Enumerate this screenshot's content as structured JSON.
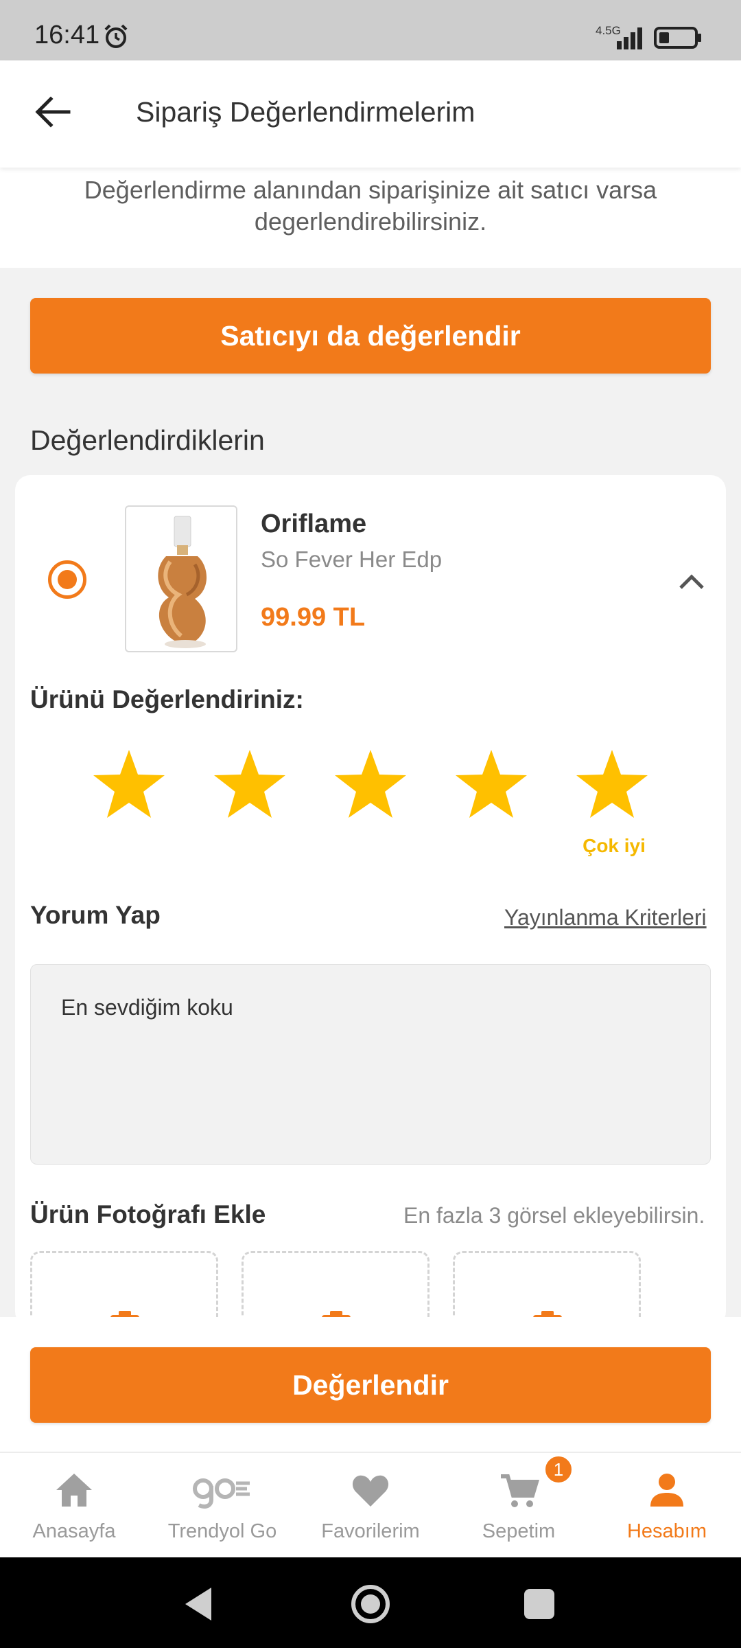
{
  "status_bar": {
    "time": "16:41",
    "network": "4.5G"
  },
  "header": {
    "title": "Sipariş Değerlendirmelerim"
  },
  "info": {
    "line1": "Değerlendirme alanından siparişinize ait satıcı varsa",
    "line2": "degerlendirebilirsiniz."
  },
  "seller_button": {
    "label": "Satıcıyı da değerlendir"
  },
  "reviewed_section": {
    "title": "Değerlendirdiklerin"
  },
  "product": {
    "brand": "Oriflame",
    "name": "So Fever Her Edp",
    "price": "99.99 TL",
    "selected": true
  },
  "rating": {
    "title": "Ürünü Değerlendiriniz:",
    "stars": 5,
    "max_stars": 5,
    "label": "Çok iyi",
    "color": "#ffc000"
  },
  "comment": {
    "title": "Yorum Yap",
    "criteria_link": "Yayınlanma Kriterleri",
    "text": "En sevdiğim koku"
  },
  "photo": {
    "title": "Ürün Fotoğrafı Ekle",
    "hint": "En fazla 3 görsel ekleyebilirsin.",
    "slot_count": 3
  },
  "submit_button": {
    "label": "Değerlendir"
  },
  "bottom_nav": {
    "items": [
      {
        "label": "Anasayfa",
        "icon": "home-icon"
      },
      {
        "label": "Trendyol Go",
        "icon": "go-icon"
      },
      {
        "label": "Favorilerim",
        "icon": "heart-icon"
      },
      {
        "label": "Sepetim",
        "icon": "cart-icon",
        "badge": "1"
      },
      {
        "label": "Hesabım",
        "icon": "user-icon",
        "active": true
      }
    ]
  },
  "colors": {
    "accent": "#f27a1a",
    "star": "#ffc000"
  }
}
